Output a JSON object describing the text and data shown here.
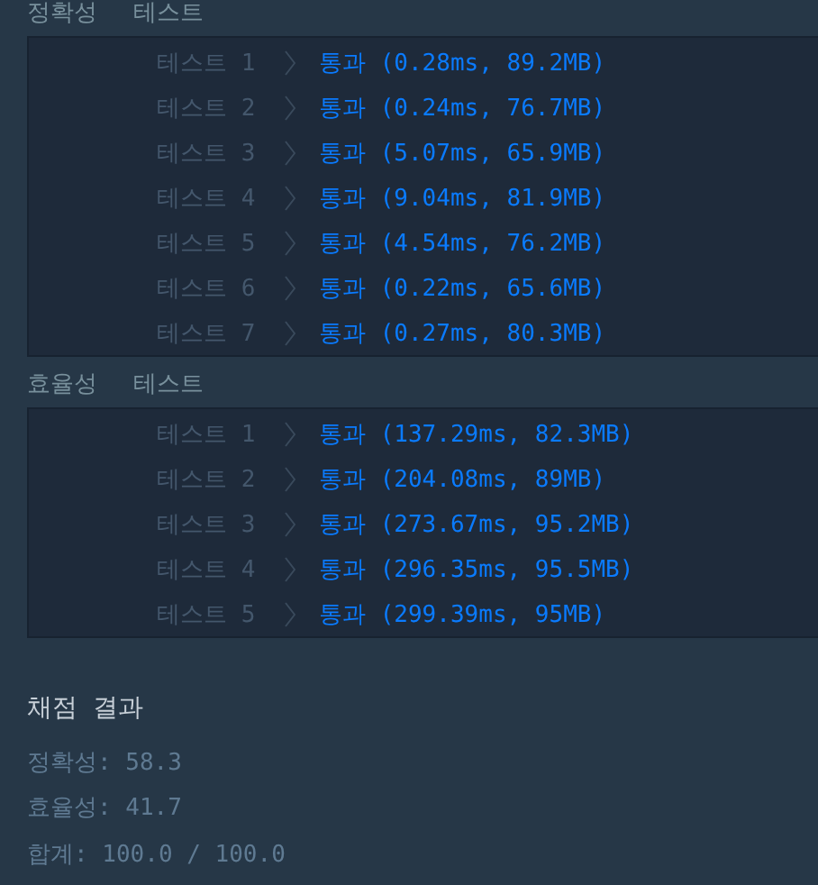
{
  "sections": [
    {
      "name": "정확성",
      "label": "테스트",
      "tests": [
        {
          "label": "테스트 1",
          "result": "통과 (0.28ms, 89.2MB)"
        },
        {
          "label": "테스트 2",
          "result": "통과 (0.24ms, 76.7MB)"
        },
        {
          "label": "테스트 3",
          "result": "통과 (5.07ms, 65.9MB)"
        },
        {
          "label": "테스트 4",
          "result": "통과 (9.04ms, 81.9MB)"
        },
        {
          "label": "테스트 5",
          "result": "통과 (4.54ms, 76.2MB)"
        },
        {
          "label": "테스트 6",
          "result": "통과 (0.22ms, 65.6MB)"
        },
        {
          "label": "테스트 7",
          "result": "통과 (0.27ms, 80.3MB)"
        }
      ]
    },
    {
      "name": "효율성",
      "label": "테스트",
      "tests": [
        {
          "label": "테스트 1",
          "result": "통과 (137.29ms, 82.3MB)"
        },
        {
          "label": "테스트 2",
          "result": "통과 (204.08ms, 89MB)"
        },
        {
          "label": "테스트 3",
          "result": "통과 (273.67ms, 95.2MB)"
        },
        {
          "label": "테스트 4",
          "result": "통과 (296.35ms, 95.5MB)"
        },
        {
          "label": "테스트 5",
          "result": "통과 (299.39ms, 95MB)"
        }
      ]
    }
  ],
  "summary": {
    "title": "채점 결과",
    "lines": [
      "정확성: 58.3",
      "효율성: 41.7",
      "합계: 100.0 / 100.0"
    ]
  }
}
